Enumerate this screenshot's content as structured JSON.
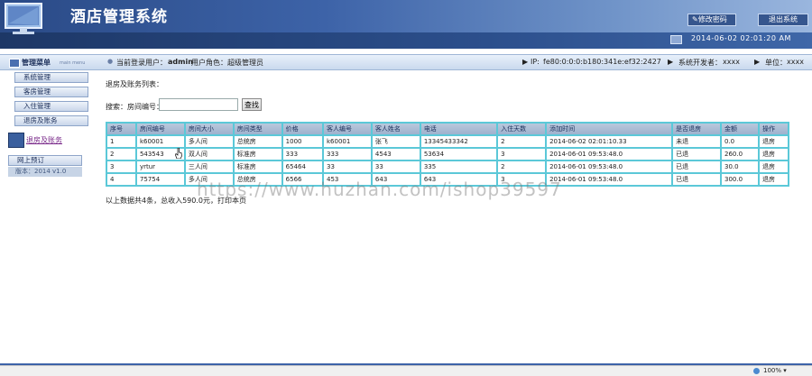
{
  "app": {
    "title": "酒店管理系统"
  },
  "header": {
    "change_password": "修改密码",
    "logout": "退出系统",
    "datetime": "2014-06-02 02:01:20 AM"
  },
  "infobar": {
    "menu_title": "管理菜单",
    "menu_title_en": "main menu",
    "current_user_label": "当前登录用户：",
    "current_user": "admin",
    "role_label": "用户角色：",
    "role": "超级管理员",
    "ip_label": "IP:",
    "ip": "fe80:0:0:0:b180:341e:ef32:2427",
    "developer_label": "系统开发者：",
    "developer": "xxxx",
    "unit_label": "单位：",
    "unit": "xxxx"
  },
  "sidebar": {
    "items": [
      {
        "label": "系统管理"
      },
      {
        "label": "客房管理"
      },
      {
        "label": "入住管理"
      },
      {
        "label": "退房及账务"
      }
    ],
    "active_label": "退房及账务",
    "online_order": "网上预订",
    "version": "版本：2014 v1.0"
  },
  "main": {
    "heading": "退房及账务列表：",
    "search_label": "搜索：房间编号：",
    "search_value": "",
    "search_button": "查找",
    "columns": [
      "序号",
      "房间编号",
      "房间大小",
      "房间类型",
      "价格",
      "客人编号",
      "客人姓名",
      "电话",
      "入住天数",
      "添加时间",
      "是否退房",
      "金额",
      "操作"
    ],
    "rows": [
      [
        "1",
        "k60001",
        "多人间",
        "总统房",
        "1000",
        "k60001",
        "张飞",
        "13345433342",
        "2",
        "2014-06-02 02:01:10.33",
        "未退",
        "0.0",
        "退房"
      ],
      [
        "2",
        "543543",
        "双人间",
        "标准房",
        "333",
        "333",
        "4543",
        "53634",
        "3",
        "2014-06-01 09:53:48.0",
        "已退",
        "260.0",
        "退房"
      ],
      [
        "3",
        "yrtur",
        "三人间",
        "标准房",
        "65464",
        "33",
        "33",
        "335",
        "2",
        "2014-06-01 09:53:48.0",
        "已退",
        "30.0",
        "退房"
      ],
      [
        "4",
        "75754",
        "多人间",
        "总统房",
        "6566",
        "453",
        "643",
        "643",
        "3",
        "2014-06-01 09:53:48.0",
        "已退",
        "300.0",
        "退房"
      ]
    ],
    "summary": "以上数据共4条，总收入590.0元，打印本页"
  },
  "watermark": "https://www.huzhan.com/ishop39597",
  "status": {
    "zoom": "100%"
  }
}
